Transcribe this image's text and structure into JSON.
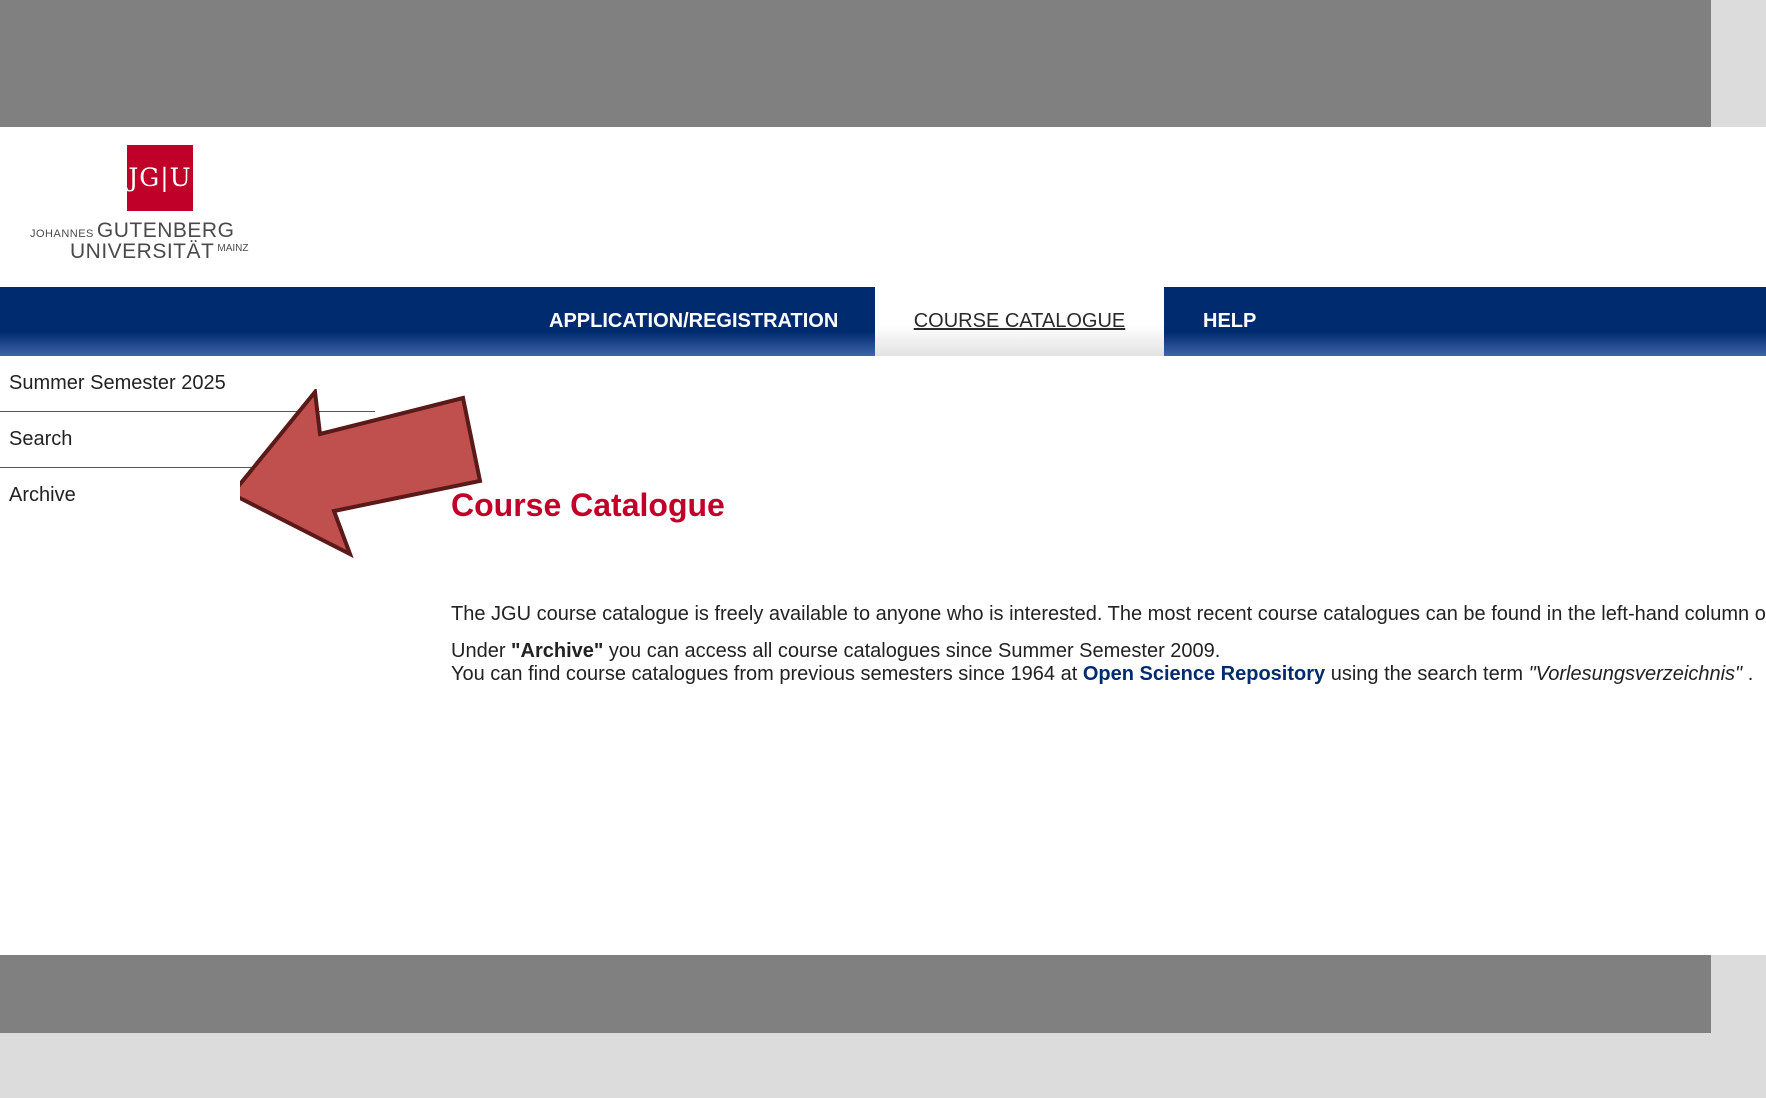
{
  "logo": {
    "mark": "JG|U",
    "line1_small": "JOHANNES",
    "line1_big": "GUTENBERG",
    "line2_big": "UNIVERSITÄT",
    "line2_small": "MAINZ"
  },
  "nav": {
    "items": [
      {
        "label": "APPLICATION/REGISTRATION"
      },
      {
        "label": "COURSE CATALOGUE"
      },
      {
        "label": "HELP"
      }
    ]
  },
  "sidebar": {
    "items": [
      {
        "label": "Summer Semester 2025"
      },
      {
        "label": "Search"
      },
      {
        "label": "Archive"
      }
    ]
  },
  "main": {
    "title": "Course Catalogue",
    "intro": "The JGU course catalogue is freely available to anyone who is interested. The most recent course catalogues can be found in the left-hand column or",
    "para2_prefix": "Under ",
    "archive_term": "\"Archive\"",
    "para2_suffix": " you can access all course catalogues since Summer Semester 2009.",
    "para3_prefix": "You can find course catalogues from previous semesters since 1964 at ",
    "osr_link": "Open Science Repository",
    "para3_middle": " using the search term ",
    "search_term": "\"Vorlesungsverzeichnis\"",
    "para3_suffix": " ."
  },
  "colors": {
    "nav_blue": "#002b6e",
    "title_red": "#c1002a",
    "logo_red": "#c1002a",
    "arrow_fill": "#c0504d",
    "arrow_stroke": "#5a1a1a"
  }
}
